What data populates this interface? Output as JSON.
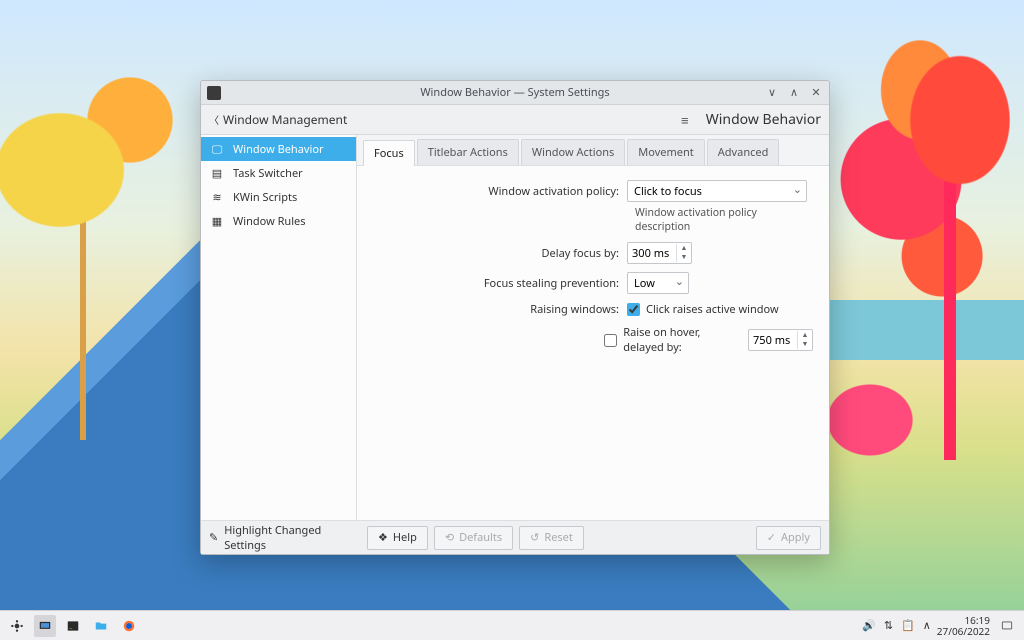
{
  "window": {
    "title": "Window Behavior — System Settings",
    "breadcrumb_back": "Window Management",
    "page_title": "Window Behavior"
  },
  "sidebar": {
    "items": [
      {
        "label": "Window Behavior",
        "icon": "monitor-icon",
        "selected": true
      },
      {
        "label": "Task Switcher",
        "icon": "stack-icon",
        "selected": false
      },
      {
        "label": "KWin Scripts",
        "icon": "script-icon",
        "selected": false
      },
      {
        "label": "Window Rules",
        "icon": "rules-icon",
        "selected": false
      }
    ]
  },
  "tabs": [
    "Focus",
    "Titlebar Actions",
    "Window Actions",
    "Movement",
    "Advanced"
  ],
  "active_tab": "Focus",
  "form": {
    "activation_label": "Window activation policy:",
    "activation_value": "Click to focus",
    "activation_desc": "Window activation policy description",
    "delay_label": "Delay focus by:",
    "delay_value": "300 ms",
    "steal_label": "Focus stealing prevention:",
    "steal_value": "Low",
    "raising_label": "Raising windows:",
    "raise_click_checked": true,
    "raise_click_label": "Click raises active window",
    "raise_hover_checked": false,
    "raise_hover_label": "Raise on hover, delayed by:",
    "raise_hover_delay": "750 ms"
  },
  "footer": {
    "highlight": "Highlight Changed Settings",
    "help": "Help",
    "defaults": "Defaults",
    "reset": "Reset",
    "apply": "Apply"
  },
  "taskbar": {
    "time": "16:19",
    "date": "27/06/2022"
  }
}
